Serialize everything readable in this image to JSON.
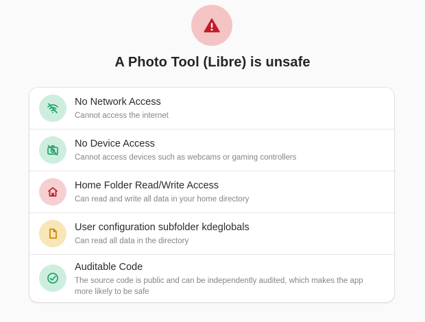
{
  "header": {
    "title": "A Photo Tool (Libre) is unsafe",
    "hero_icon": "warning-icon"
  },
  "permissions": [
    {
      "title": "No Network Access",
      "subtitle": "Cannot access the internet",
      "icon": "network-disabled-icon",
      "tone": "green"
    },
    {
      "title": "No Device Access",
      "subtitle": "Cannot access devices such as webcams or gaming controllers",
      "icon": "camera-disabled-icon",
      "tone": "green"
    },
    {
      "title": "Home Folder Read/Write Access",
      "subtitle": "Can read and write all data in your home directory",
      "icon": "home-icon",
      "tone": "red"
    },
    {
      "title": "User configuration subfolder kdeglobals",
      "subtitle": "Can read all data in the directory",
      "icon": "document-icon",
      "tone": "yellow"
    },
    {
      "title": "Auditable Code",
      "subtitle": "The source code is public and can be independently audited, which makes the app more likely to be safe",
      "icon": "check-circle-icon",
      "tone": "green"
    }
  ],
  "colors": {
    "danger": "#c01c28",
    "danger_bg": "#f4c4c5",
    "safe": "#26a269",
    "safe_bg": "#cdeede",
    "warning": "#c88800",
    "warning_bg": "#f8e6b8"
  }
}
